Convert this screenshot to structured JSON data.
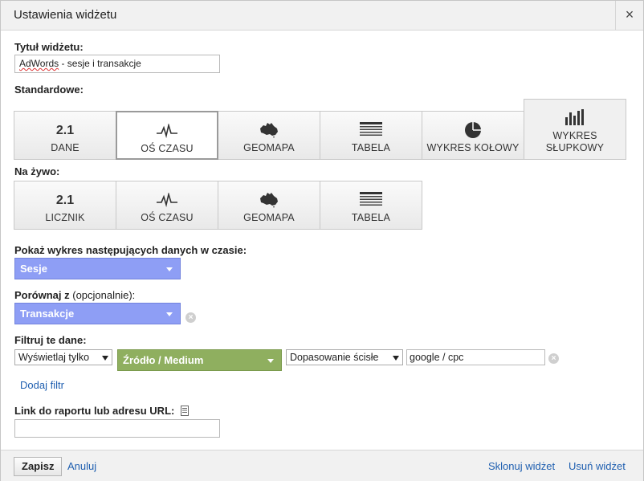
{
  "dialog": {
    "title": "Ustawienia widżetu",
    "close_glyph": "×"
  },
  "widget_title": {
    "label": "Tytuł widżetu:",
    "value_part1": "AdWords",
    "value_part2": " - sesje i transakcje"
  },
  "standard": {
    "label": "Standardowe:",
    "tiles": [
      {
        "icon": "number-icon",
        "icon_text": "2.1",
        "label": "DANE"
      },
      {
        "icon": "timeline-icon",
        "label": "OŚ CZASU"
      },
      {
        "icon": "geomap-icon",
        "label": "GEOMAPA"
      },
      {
        "icon": "table-icon",
        "label": "TABELA"
      },
      {
        "icon": "pie-chart-icon",
        "label": "WYKRES KOŁOWY"
      },
      {
        "icon": "bar-chart-icon",
        "label_line1": "WYKRES",
        "label_line2": "SŁUPKOWY"
      }
    ]
  },
  "live": {
    "label": "Na żywo:",
    "tiles": [
      {
        "icon": "number-icon",
        "icon_text": "2.1",
        "label": "LICZNIK"
      },
      {
        "icon": "timeline-icon",
        "label": "OŚ CZASU"
      },
      {
        "icon": "geomap-icon",
        "label": "GEOMAPA"
      },
      {
        "icon": "table-icon",
        "label": "TABELA"
      }
    ]
  },
  "metric": {
    "label": "Pokaż wykres następujących danych w czasie:",
    "selected": "Sesje"
  },
  "compare": {
    "label_bold": "Porównaj z",
    "label_optional": " (opcjonalnie):",
    "selected": "Transakcje"
  },
  "filter": {
    "label": "Filtruj te dane:",
    "mode": "Wyświetlaj tylko",
    "dimension": "Źródło / Medium",
    "match": "Dopasowanie ścisłe",
    "value": "google / cpc",
    "add_filter": "Dodaj filtr"
  },
  "link_field": {
    "label": "Link do raportu lub adresu URL:",
    "value": ""
  },
  "footer": {
    "save": "Zapisz",
    "cancel": "Anuluj",
    "clone": "Sklonuj widżet",
    "delete": "Usuń widżet"
  },
  "colors": {
    "blue_select": "#8e9ef5",
    "green_select": "#8faf5f",
    "link": "#1f5fb0"
  }
}
